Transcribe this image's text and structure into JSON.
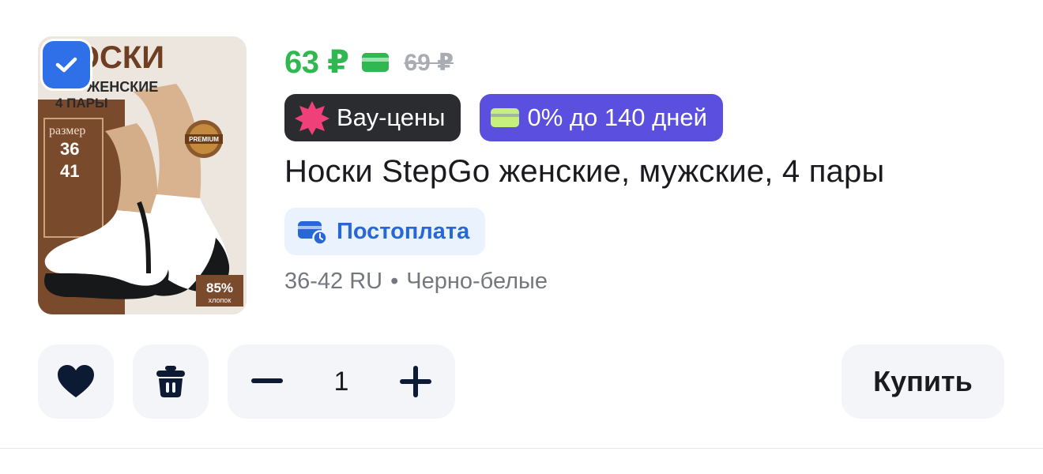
{
  "product": {
    "image_alt": "Носки StepGo",
    "image_text": {
      "brand": "НОСКИ",
      "line2": "ЖЕНСКИЕ",
      "count": "4 ПАРЫ",
      "size_label": "размер",
      "size_from": "36",
      "size_to": "41",
      "premium": "PREMIUM",
      "percent": "85%",
      "material": "хлопок"
    },
    "price_current": "63 ₽",
    "price_old": "69 ₽",
    "title": "Носки StepGo женские, мужские, 4 пары",
    "badges": [
      {
        "label": "Вау-цены",
        "icon": "star-burst-icon",
        "color": "#2b2c30",
        "icon_color": "#f0407a"
      },
      {
        "label": "0% до 140 дней",
        "icon": "card-icon",
        "color": "#5b4fe0",
        "icon_color": "#c6ef7e"
      }
    ],
    "postpay": {
      "label": "Постоплата",
      "icon": "card-clock-icon",
      "color": "#2868d6",
      "bg": "#eaf3fd"
    },
    "variant": {
      "size": "36-42 RU",
      "separator": "•",
      "color": "Черно-белые"
    }
  },
  "actions": {
    "favorite_icon": "heart-icon",
    "delete_icon": "trash-icon",
    "quantity": "1",
    "buy_label": "Купить"
  },
  "colors": {
    "accent": "#2f6fe8",
    "price": "#2fb84f",
    "old_price": "#a9acb3",
    "button_bg": "#f3f5f8"
  }
}
